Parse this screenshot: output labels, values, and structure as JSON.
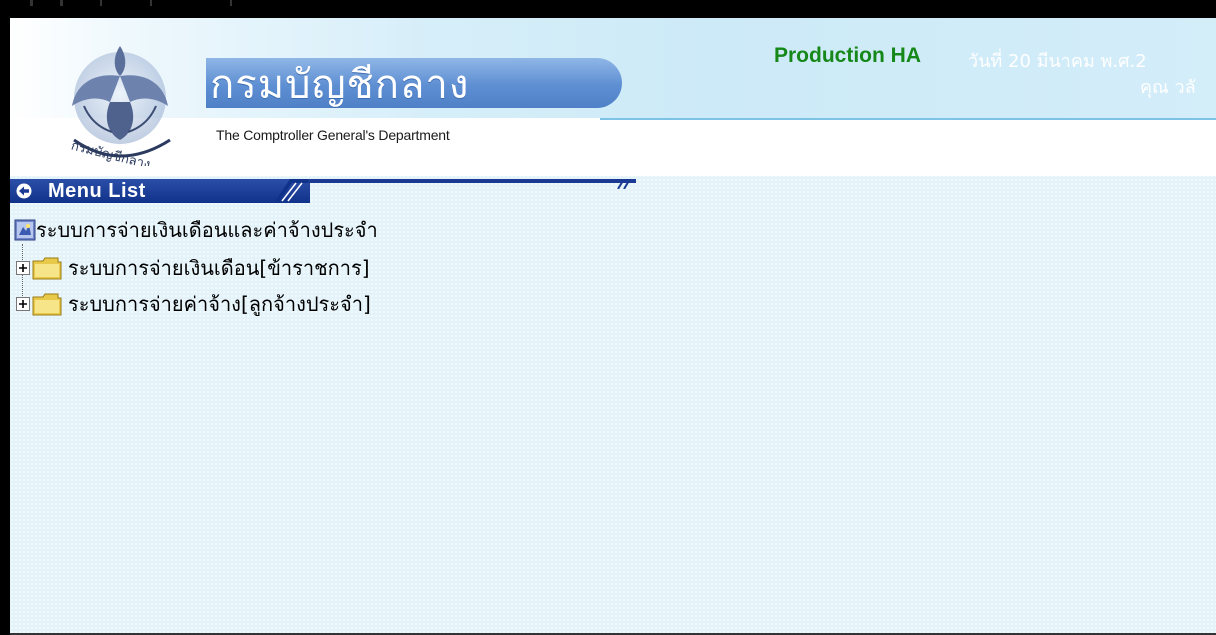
{
  "header": {
    "logo_thai": "กรมบัญชีกลาง",
    "logo_english": "The Comptroller General's Department",
    "environment": "Production HA",
    "date_text": "วันที่ 20 มีนาคม พ.ศ.2",
    "user_text": "คุณ วลั"
  },
  "menu": {
    "title": "Menu List",
    "root": {
      "label": "ระบบการจ่ายเงินเดือนและค่าจ้างประจำ",
      "icon": "system-icon"
    },
    "items": [
      {
        "label": "ระบบการจ่ายเงินเดือน[ข้าราชการ]",
        "icon": "folder-icon",
        "expander": "plus-icon"
      },
      {
        "label": "ระบบการจ่ายค่าจ้าง[ลูกจ้างประจำ]",
        "icon": "folder-icon",
        "expander": "plus-icon"
      }
    ]
  },
  "colors": {
    "environment": "#16881a",
    "menu_bar": "#10328a",
    "background": "#e4f3fa"
  }
}
